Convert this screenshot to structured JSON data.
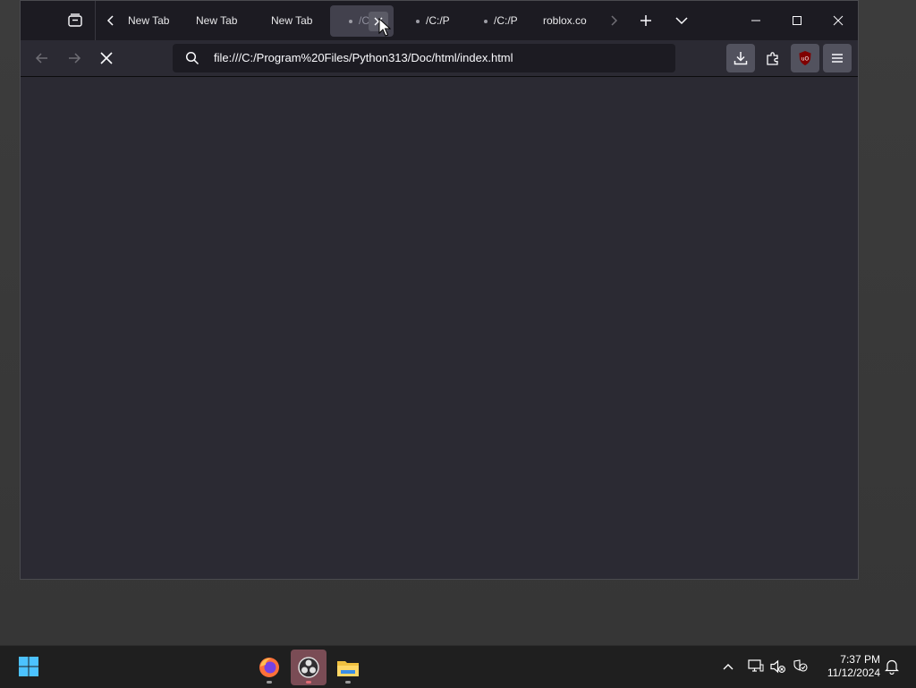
{
  "tabs": [
    {
      "label": "New Tab"
    },
    {
      "label": "New Tab"
    },
    {
      "label": "New Tab"
    },
    {
      "label": "/C:/P",
      "active": true
    },
    {
      "label": "/C:/P"
    },
    {
      "label": "/C:/P"
    },
    {
      "label": "roblox.co"
    }
  ],
  "address": {
    "url": "file:///C:/Program%20Files/Python313/Doc/html/index.html"
  },
  "taskbar": {
    "apps": [
      {
        "icon": "firefox-icon"
      },
      {
        "icon": "obs-icon"
      },
      {
        "icon": "file-explorer-icon"
      }
    ]
  },
  "clock": {
    "time": "7:37 PM",
    "date": "11/12/2024"
  },
  "colors": {
    "accent": "#0078d4",
    "ublock": "#800000",
    "active_tab": "#42414d"
  }
}
